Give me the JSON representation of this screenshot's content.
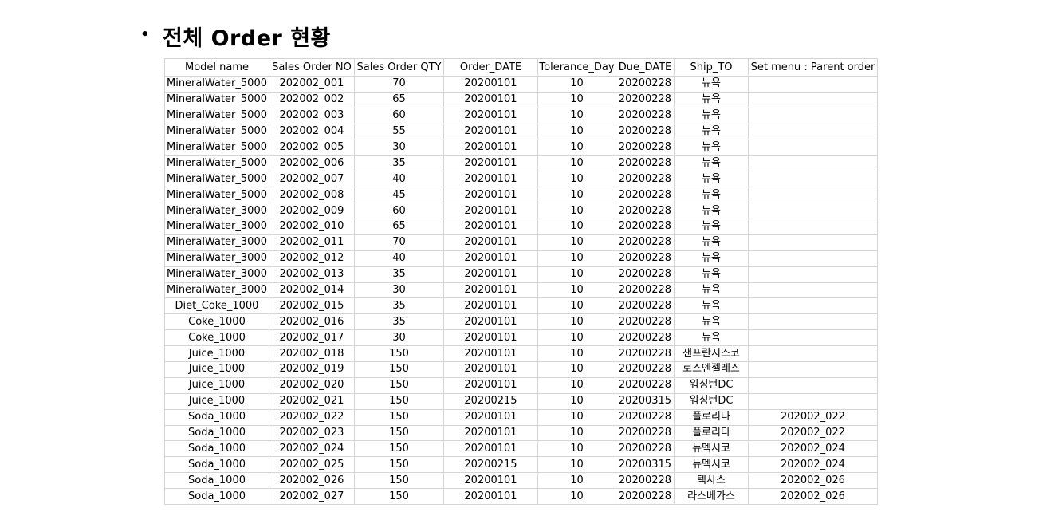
{
  "title": {
    "bullet": "•",
    "text": "전체 Order 현황"
  },
  "table": {
    "columns": [
      "Model name",
      "Sales Order NO",
      "Sales Order QTY",
      "Order_DATE",
      "Tolerance_Day",
      "Due_DATE",
      "Ship_TO",
      "Set menu : Parent order"
    ],
    "rows": [
      [
        "MineralWater_5000",
        "202002_001",
        "70",
        "20200101",
        "10",
        "20200228",
        "뉴욕",
        ""
      ],
      [
        "MineralWater_5000",
        "202002_002",
        "65",
        "20200101",
        "10",
        "20200228",
        "뉴욕",
        ""
      ],
      [
        "MineralWater_5000",
        "202002_003",
        "60",
        "20200101",
        "10",
        "20200228",
        "뉴욕",
        ""
      ],
      [
        "MineralWater_5000",
        "202002_004",
        "55",
        "20200101",
        "10",
        "20200228",
        "뉴욕",
        ""
      ],
      [
        "MineralWater_5000",
        "202002_005",
        "30",
        "20200101",
        "10",
        "20200228",
        "뉴욕",
        ""
      ],
      [
        "MineralWater_5000",
        "202002_006",
        "35",
        "20200101",
        "10",
        "20200228",
        "뉴욕",
        ""
      ],
      [
        "MineralWater_5000",
        "202002_007",
        "40",
        "20200101",
        "10",
        "20200228",
        "뉴욕",
        ""
      ],
      [
        "MineralWater_5000",
        "202002_008",
        "45",
        "20200101",
        "10",
        "20200228",
        "뉴욕",
        ""
      ],
      [
        "MineralWater_3000",
        "202002_009",
        "60",
        "20200101",
        "10",
        "20200228",
        "뉴욕",
        ""
      ],
      [
        "MineralWater_3000",
        "202002_010",
        "65",
        "20200101",
        "10",
        "20200228",
        "뉴욕",
        ""
      ],
      [
        "MineralWater_3000",
        "202002_011",
        "70",
        "20200101",
        "10",
        "20200228",
        "뉴욕",
        ""
      ],
      [
        "MineralWater_3000",
        "202002_012",
        "40",
        "20200101",
        "10",
        "20200228",
        "뉴욕",
        ""
      ],
      [
        "MineralWater_3000",
        "202002_013",
        "35",
        "20200101",
        "10",
        "20200228",
        "뉴욕",
        ""
      ],
      [
        "MineralWater_3000",
        "202002_014",
        "30",
        "20200101",
        "10",
        "20200228",
        "뉴욕",
        ""
      ],
      [
        "Diet_Coke_1000",
        "202002_015",
        "35",
        "20200101",
        "10",
        "20200228",
        "뉴욕",
        ""
      ],
      [
        "Coke_1000",
        "202002_016",
        "35",
        "20200101",
        "10",
        "20200228",
        "뉴욕",
        ""
      ],
      [
        "Coke_1000",
        "202002_017",
        "30",
        "20200101",
        "10",
        "20200228",
        "뉴욕",
        ""
      ],
      [
        "Juice_1000",
        "202002_018",
        "150",
        "20200101",
        "10",
        "20200228",
        "샌프란시스코",
        ""
      ],
      [
        "Juice_1000",
        "202002_019",
        "150",
        "20200101",
        "10",
        "20200228",
        "로스엔젤레스",
        ""
      ],
      [
        "Juice_1000",
        "202002_020",
        "150",
        "20200101",
        "10",
        "20200228",
        "워싱턴DC",
        ""
      ],
      [
        "Juice_1000",
        "202002_021",
        "150",
        "20200215",
        "10",
        "20200315",
        "워싱턴DC",
        ""
      ],
      [
        "Soda_1000",
        "202002_022",
        "150",
        "20200101",
        "10",
        "20200228",
        "플로리다",
        "202002_022"
      ],
      [
        "Soda_1000",
        "202002_023",
        "150",
        "20200101",
        "10",
        "20200228",
        "플로리다",
        "202002_022"
      ],
      [
        "Soda_1000",
        "202002_024",
        "150",
        "20200101",
        "10",
        "20200228",
        "뉴멕시코",
        "202002_024"
      ],
      [
        "Soda_1000",
        "202002_025",
        "150",
        "20200215",
        "10",
        "20200315",
        "뉴멕시코",
        "202002_024"
      ],
      [
        "Soda_1000",
        "202002_026",
        "150",
        "20200101",
        "10",
        "20200228",
        "텍사스",
        "202002_026"
      ],
      [
        "Soda_1000",
        "202002_027",
        "150",
        "20200101",
        "10",
        "20200228",
        "라스베가스",
        "202002_026"
      ]
    ]
  }
}
